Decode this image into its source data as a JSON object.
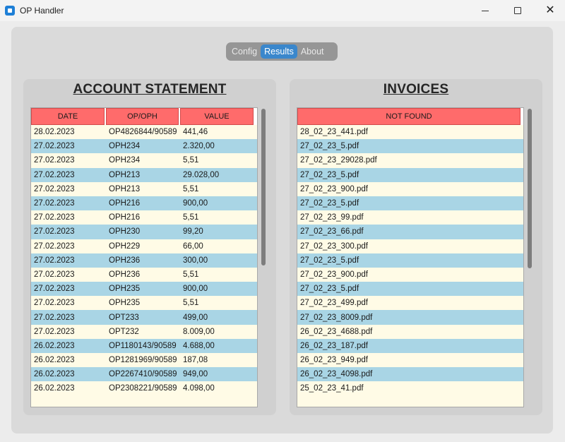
{
  "window": {
    "title": "OP Handler",
    "icon": "app-window-icon"
  },
  "tabs": [
    {
      "label": "Config",
      "active": false
    },
    {
      "label": "Results",
      "active": true
    },
    {
      "label": "About",
      "active": false
    }
  ],
  "statement": {
    "heading": "ACCOUNT STATEMENT",
    "columns": [
      "DATE",
      "OP/OPH",
      "VALUE"
    ],
    "rows": [
      [
        "28.02.2023",
        "OP4826844/90589",
        "441,46"
      ],
      [
        "27.02.2023",
        "OPH234",
        "2.320,00"
      ],
      [
        "27.02.2023",
        "OPH234",
        "5,51"
      ],
      [
        "27.02.2023",
        "OPH213",
        "29.028,00"
      ],
      [
        "27.02.2023",
        "OPH213",
        "5,51"
      ],
      [
        "27.02.2023",
        "OPH216",
        "900,00"
      ],
      [
        "27.02.2023",
        "OPH216",
        "5,51"
      ],
      [
        "27.02.2023",
        "OPH230",
        "99,20"
      ],
      [
        "27.02.2023",
        "OPH229",
        "66,00"
      ],
      [
        "27.02.2023",
        "OPH236",
        "300,00"
      ],
      [
        "27.02.2023",
        "OPH236",
        "5,51"
      ],
      [
        "27.02.2023",
        "OPH235",
        "900,00"
      ],
      [
        "27.02.2023",
        "OPH235",
        "5,51"
      ],
      [
        "27.02.2023",
        "OPT233",
        "499,00"
      ],
      [
        "27.02.2023",
        "OPT232",
        "8.009,00"
      ],
      [
        "26.02.2023",
        "OP1180143/90589",
        "4.688,00"
      ],
      [
        "26.02.2023",
        "OP1281969/90589",
        "187,08"
      ],
      [
        "26.02.2023",
        "OP2267410/90589",
        "949,00"
      ],
      [
        "26.02.2023",
        "OP2308221/90589",
        "4.098,00"
      ]
    ]
  },
  "invoices": {
    "heading": "INVOICES",
    "column": "NOT FOUND",
    "rows": [
      "28_02_23_441.pdf",
      "27_02_23_5.pdf",
      "27_02_23_29028.pdf",
      "27_02_23_5.pdf",
      "27_02_23_900.pdf",
      "27_02_23_5.pdf",
      "27_02_23_99.pdf",
      "27_02_23_66.pdf",
      "27_02_23_300.pdf",
      "27_02_23_5.pdf",
      "27_02_23_900.pdf",
      "27_02_23_5.pdf",
      "27_02_23_499.pdf",
      "27_02_23_8009.pdf",
      "26_02_23_4688.pdf",
      "26_02_23_187.pdf",
      "26_02_23_949.pdf",
      "26_02_23_4098.pdf",
      "25_02_23_41.pdf"
    ]
  },
  "colors": {
    "header_fill": "#ff6b6b",
    "row_even": "#a9d5e5",
    "row_odd": "#fffbe6",
    "tab_active": "#3a87cc"
  }
}
